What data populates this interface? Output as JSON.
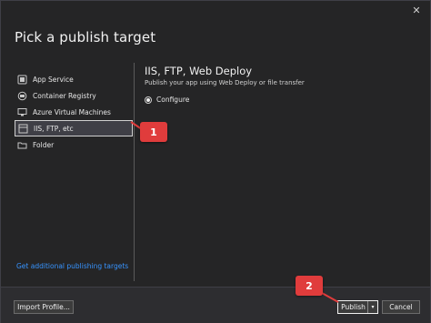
{
  "window": {
    "close_glyph": "✕"
  },
  "dialog": {
    "title": "Pick a publish target"
  },
  "targets": [
    {
      "label": "App Service",
      "icon": "app-service-icon"
    },
    {
      "label": "Container Registry",
      "icon": "container-registry-icon"
    },
    {
      "label": "Azure Virtual Machines",
      "icon": "virtual-machine-icon"
    },
    {
      "label": "IIS, FTP, etc",
      "icon": "globe-icon",
      "selected": true
    },
    {
      "label": "Folder",
      "icon": "folder-icon"
    }
  ],
  "detail": {
    "title": "IIS, FTP, Web Deploy",
    "subtitle": "Publish your app using Web Deploy or file transfer",
    "option_label": "Configure"
  },
  "links": {
    "additional_targets": "Get additional publishing targets"
  },
  "footer": {
    "import_label": "Import Profile...",
    "publish_label": "Publish",
    "publish_caret": "▾",
    "cancel_label": "Cancel"
  },
  "callouts": {
    "one": "1",
    "two": "2",
    "color": "#e03c3c"
  },
  "colors": {
    "accent_link": "#3794ff",
    "background": "#252526",
    "selected_bg": "#3f3f46"
  }
}
